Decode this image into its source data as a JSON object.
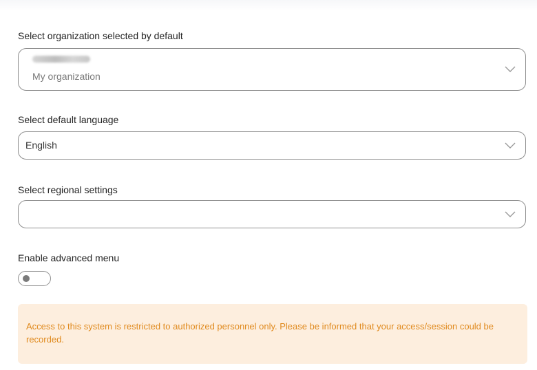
{
  "organization": {
    "label": "Select organization selected by default",
    "selected_name_blurred": true,
    "selected_subtitle": "My organization"
  },
  "language": {
    "label": "Select default language",
    "value": "English"
  },
  "regional": {
    "label": "Select regional settings",
    "value": ""
  },
  "advanced_menu": {
    "label": "Enable advanced menu",
    "enabled": false
  },
  "notice": {
    "text": "Access to this system is restricted to authorized personnel only. Please be informed that your access/session could be recorded."
  },
  "colors": {
    "border": "#8f8f8f",
    "notice_bg": "#fdeede",
    "notice_text": "#e08a1e"
  },
  "icons": {
    "dropdown": "chevron-down-icon"
  }
}
